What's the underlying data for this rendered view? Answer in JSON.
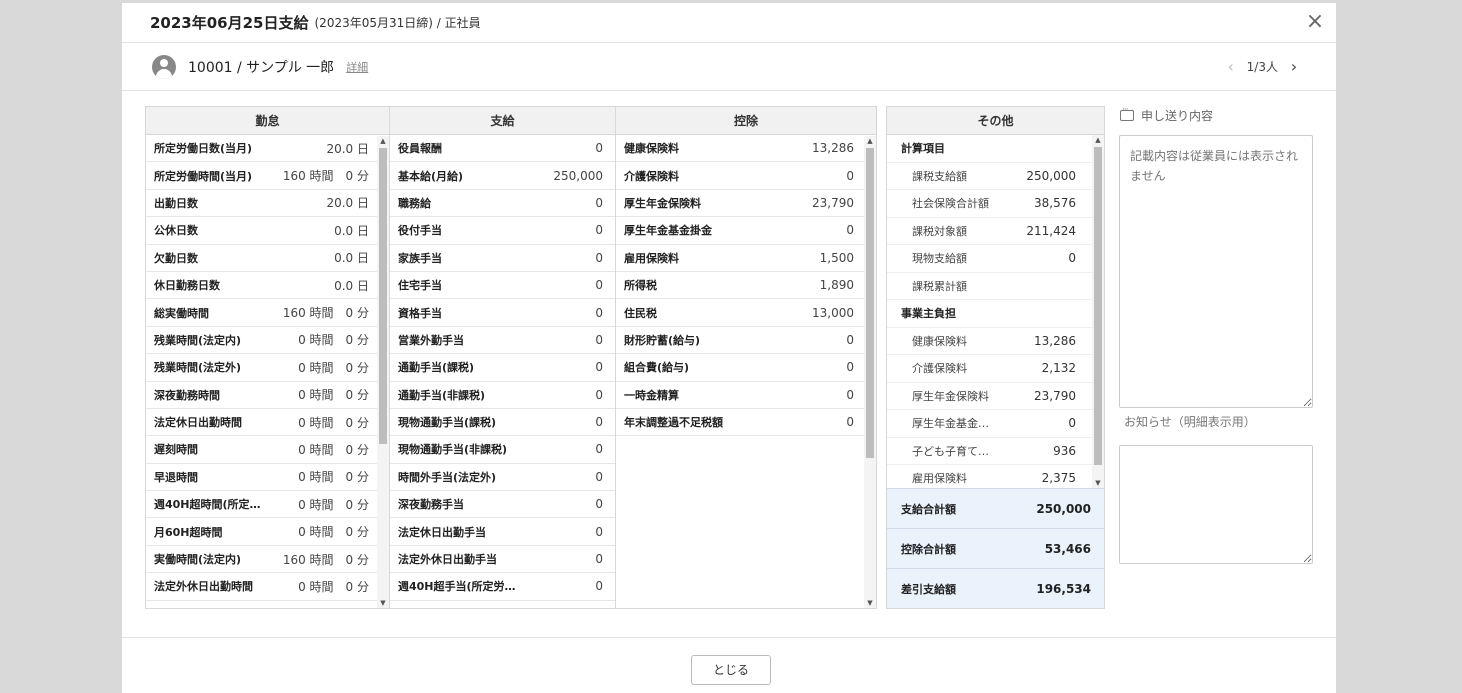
{
  "header": {
    "title": "2023年06月25日支給",
    "subtitle": "(2023年05月31日締) / 正社員",
    "close_icon": "×"
  },
  "employee": {
    "name": "10001 / サンプル 一郎",
    "detail_link": "詳細",
    "pager": {
      "prev": "‹",
      "count": "1/3人",
      "next": "›"
    }
  },
  "attendance": {
    "heading": "勤怠",
    "rows": [
      {
        "label": "所定労働日数(当月)",
        "value": "20.0 日"
      },
      {
        "label": "所定労働時間(当月)",
        "value": "160 時間　0 分"
      },
      {
        "label": "出勤日数",
        "value": "20.0 日"
      },
      {
        "label": "公休日数",
        "value": "0.0 日"
      },
      {
        "label": "欠勤日数",
        "value": "0.0 日"
      },
      {
        "label": "休日勤務日数",
        "value": "0.0 日"
      },
      {
        "label": "総実働時間",
        "value": "160 時間　0 分"
      },
      {
        "label": "残業時間(法定内)",
        "value": "0 時間　0 分"
      },
      {
        "label": "残業時間(法定外)",
        "value": "0 時間　0 分"
      },
      {
        "label": "深夜勤務時間",
        "value": "0 時間　0 分"
      },
      {
        "label": "法定休日出勤時間",
        "value": "0 時間　0 分"
      },
      {
        "label": "遅刻時間",
        "value": "0 時間　0 分"
      },
      {
        "label": "早退時間",
        "value": "0 時間　0 分"
      },
      {
        "label": "週40H超時間(所定…",
        "value": "0 時間　0 分"
      },
      {
        "label": "月60H超時間",
        "value": "0 時間　0 分"
      },
      {
        "label": "実働時間(法定内)",
        "value": "160 時間　0 分"
      },
      {
        "label": "法定外休日出勤時間",
        "value": "0 時間　0 分"
      }
    ]
  },
  "payment": {
    "heading": "支給",
    "rows": [
      {
        "label": "役員報酬",
        "value": "0"
      },
      {
        "label": "基本給(月給)",
        "value": "250,000"
      },
      {
        "label": "職務給",
        "value": "0"
      },
      {
        "label": "役付手当",
        "value": "0"
      },
      {
        "label": "家族手当",
        "value": "0"
      },
      {
        "label": "住宅手当",
        "value": "0"
      },
      {
        "label": "資格手当",
        "value": "0"
      },
      {
        "label": "営業外勤手当",
        "value": "0"
      },
      {
        "label": "通勤手当(課税)",
        "value": "0"
      },
      {
        "label": "通勤手当(非課税)",
        "value": "0"
      },
      {
        "label": "現物通勤手当(課税)",
        "value": "0"
      },
      {
        "label": "現物通勤手当(非課税)",
        "value": "0"
      },
      {
        "label": "時間外手当(法定外)",
        "value": "0"
      },
      {
        "label": "深夜勤務手当",
        "value": "0"
      },
      {
        "label": "法定休日出勤手当",
        "value": "0"
      },
      {
        "label": "法定外休日出勤手当",
        "value": "0"
      },
      {
        "label": "週40H超手当(所定労…",
        "value": "0"
      }
    ]
  },
  "deduction": {
    "heading": "控除",
    "rows": [
      {
        "label": "健康保険料",
        "value": "13,286"
      },
      {
        "label": "介護保険料",
        "value": "0"
      },
      {
        "label": "厚生年金保険料",
        "value": "23,790"
      },
      {
        "label": "厚生年金基金掛金",
        "value": "0"
      },
      {
        "label": "雇用保険料",
        "value": "1,500"
      },
      {
        "label": "所得税",
        "value": "1,890"
      },
      {
        "label": "住民税",
        "value": "13,000"
      },
      {
        "label": "財形貯蓄(給与)",
        "value": "0"
      },
      {
        "label": "組合費(給与)",
        "value": "0"
      },
      {
        "label": "一時金精算",
        "value": "0"
      },
      {
        "label": "年末調整過不足税額",
        "value": "0"
      }
    ]
  },
  "other": {
    "heading": "その他",
    "rows": [
      {
        "type": "section",
        "label": "計算項目",
        "value": ""
      },
      {
        "type": "item",
        "label": "課税支給額",
        "value": "250,000"
      },
      {
        "type": "item",
        "label": "社会保険合計額",
        "value": "38,576"
      },
      {
        "type": "item",
        "label": "課税対象額",
        "value": "211,424"
      },
      {
        "type": "item",
        "label": "現物支給額",
        "value": "0"
      },
      {
        "type": "item",
        "label": "課税累計額",
        "value": ""
      },
      {
        "type": "section",
        "label": "事業主負担",
        "value": ""
      },
      {
        "type": "item",
        "label": "健康保険料",
        "value": "13,286"
      },
      {
        "type": "item",
        "label": "介護保険料",
        "value": "2,132"
      },
      {
        "type": "item",
        "label": "厚生年金保険料",
        "value": "23,790"
      },
      {
        "type": "item",
        "label": "厚生年金基金…",
        "value": "0"
      },
      {
        "type": "item",
        "label": "子ども子育て…",
        "value": "936"
      },
      {
        "type": "item",
        "label": "雇用保険料",
        "value": "2,375"
      }
    ],
    "totals": [
      {
        "label": "支給合計額",
        "value": "250,000"
      },
      {
        "label": "控除合計額",
        "value": "53,466"
      },
      {
        "label": "差引支給額",
        "value": "196,534"
      }
    ]
  },
  "memo": {
    "label": "申し送り内容",
    "placeholder": "記載内容は従業員には表示されません",
    "notice_label": "お知らせ（明細表示用）"
  },
  "footer": {
    "close_label": "とじる"
  }
}
